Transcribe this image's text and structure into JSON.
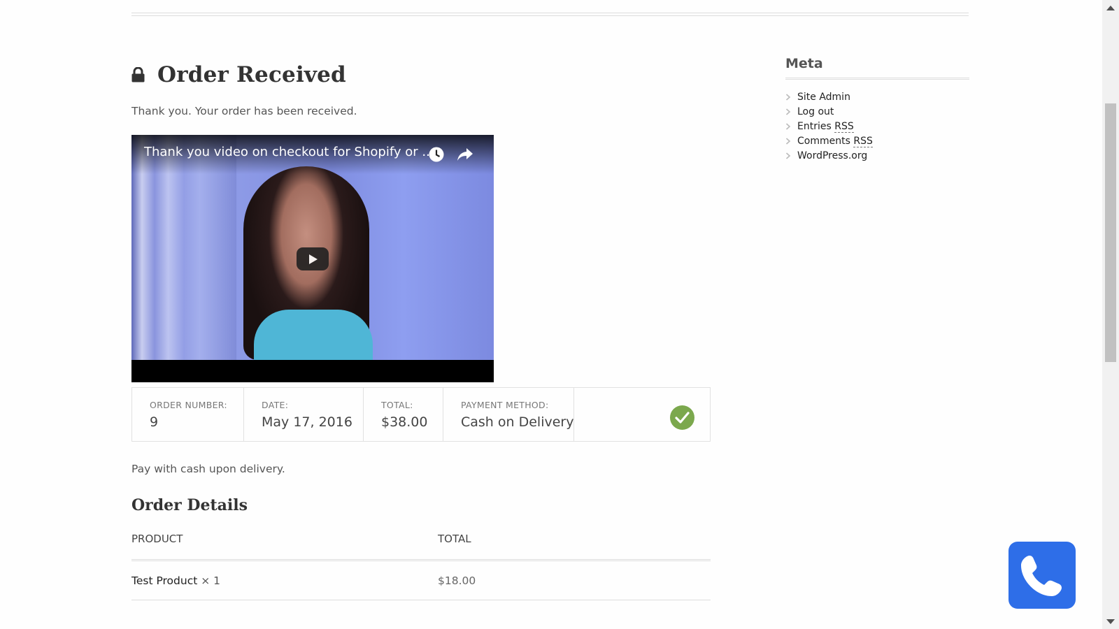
{
  "page": {
    "title": "Order Received",
    "thanks": "Thank you. Your order has been received."
  },
  "video": {
    "title": "Thank you video on checkout for Shopify or ...",
    "icons": {
      "watch_later": "clock-icon",
      "share": "share-icon",
      "play": "play-icon"
    }
  },
  "overview": {
    "order_number": {
      "label": "ORDER NUMBER:",
      "value": "9"
    },
    "date": {
      "label": "DATE:",
      "value": "May 17, 2016"
    },
    "total": {
      "label": "TOTAL:",
      "value": "$38.00"
    },
    "payment_method": {
      "label": "PAYMENT METHOD:",
      "value": "Cash on Delivery"
    }
  },
  "payment_note": "Pay with cash upon delivery.",
  "order_details": {
    "title": "Order Details",
    "columns": {
      "product": "PRODUCT",
      "total": "TOTAL"
    },
    "rows": [
      {
        "product": "Test Product",
        "qty": "× 1",
        "total": "$18.00"
      }
    ]
  },
  "sidebar": {
    "title": "Meta",
    "items": [
      {
        "text": "Site Admin"
      },
      {
        "text": "Log out"
      },
      {
        "text": "Entries ",
        "abbr": "RSS"
      },
      {
        "text": "Comments ",
        "abbr": "RSS"
      },
      {
        "text": "WordPress.org"
      }
    ]
  },
  "colors": {
    "accent_check": "#7ba84d",
    "phone_button": "#2e6ee8"
  }
}
